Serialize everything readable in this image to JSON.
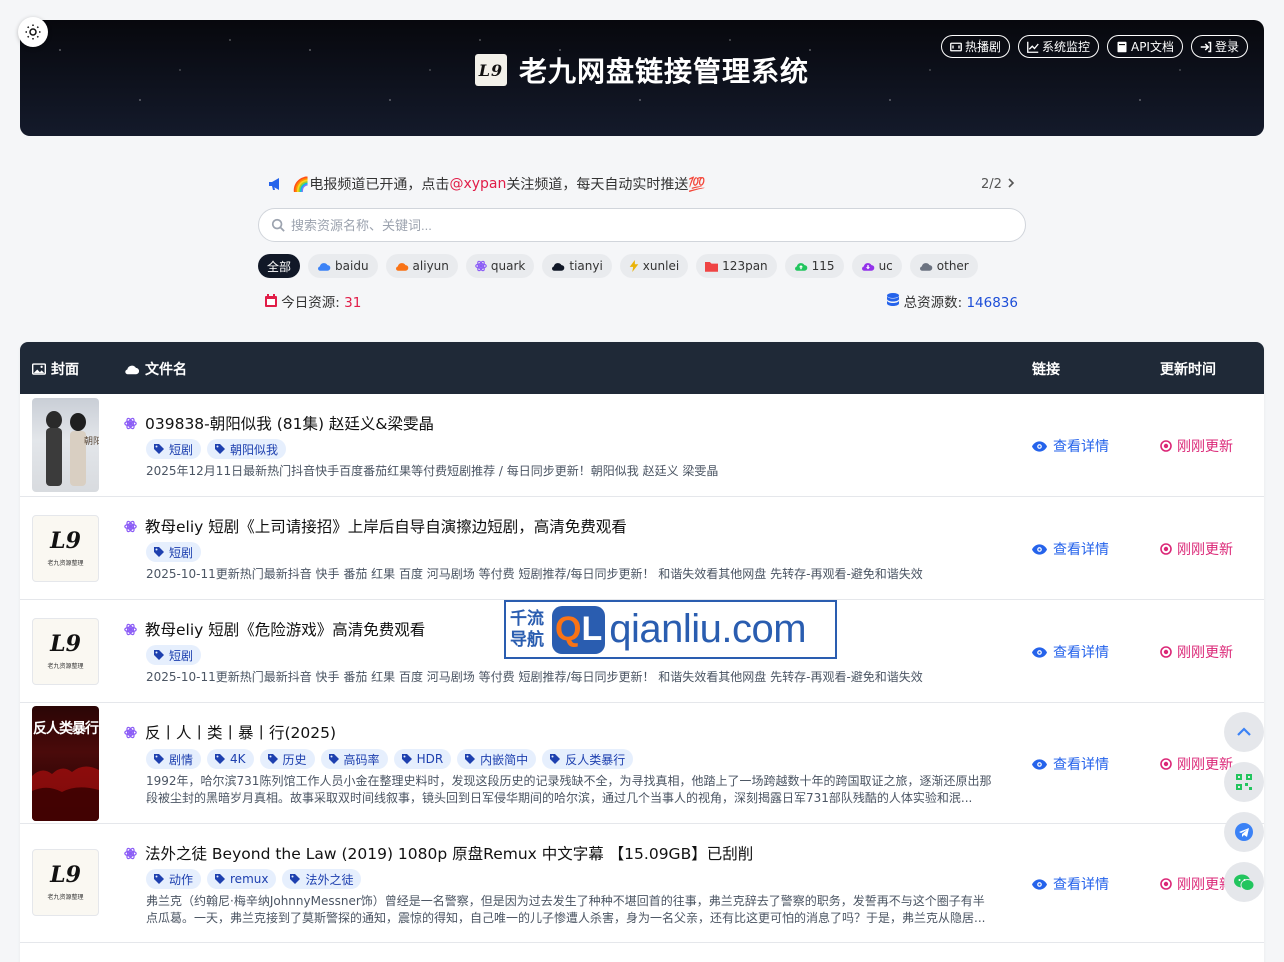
{
  "header": {
    "title": "老九网盘链接管理系统",
    "logo_text": "L9",
    "nav": [
      {
        "label": "热播剧",
        "icon": "tv-icon"
      },
      {
        "label": "系统监控",
        "icon": "chart-line-icon"
      },
      {
        "label": "API文档",
        "icon": "book-icon"
      },
      {
        "label": "登录",
        "icon": "sign-in-icon"
      }
    ]
  },
  "notice": {
    "prefix": "🌈电报频道已开通，点击 ",
    "handle": "@xypan",
    "suffix": " 关注频道，每天自动实时推送💯",
    "pager": "2/2"
  },
  "search": {
    "placeholder": "搜索资源名称、关键词..."
  },
  "filters": [
    {
      "label": "全部",
      "active": true,
      "icon": "",
      "color": ""
    },
    {
      "label": "baidu",
      "icon": "cloud-icon",
      "color": "#3b82f6"
    },
    {
      "label": "aliyun",
      "icon": "cloud-icon",
      "color": "#f97316"
    },
    {
      "label": "quark",
      "icon": "atom-icon",
      "color": "#8b5cf6"
    },
    {
      "label": "tianyi",
      "icon": "cloud-icon",
      "color": "#111827"
    },
    {
      "label": "xunlei",
      "icon": "bolt-icon",
      "color": "#eab308"
    },
    {
      "label": "123pan",
      "icon": "folder-icon",
      "color": "#ef4444"
    },
    {
      "label": "115",
      "icon": "cloud-upload-icon",
      "color": "#22c55e"
    },
    {
      "label": "uc",
      "icon": "cloud-download-icon",
      "color": "#9333ea"
    },
    {
      "label": "other",
      "icon": "cloud-icon",
      "color": "#6b7280"
    }
  ],
  "stats": {
    "today_label": "今日资源: ",
    "today_value": "31",
    "total_label": "总资源数: ",
    "total_value": "146836"
  },
  "table": {
    "headers": {
      "cover": "封面",
      "filename": "文件名",
      "link": "链接",
      "updated": "更新时间"
    },
    "rows": [
      {
        "title": "039838-朝阳似我 (81集) 赵廷义&梁雯晶",
        "tags": [
          "短剧",
          "朝阳似我"
        ],
        "desc": "2025年12月11日最新热门抖音快手百度番茄红果等付费短剧推荐 / 每日同步更新！朝阳似我 赵廷义 梁雯晶",
        "cover": "photo",
        "link_label": "查看详情",
        "updated": "刚刚更新"
      },
      {
        "title": "教母eliy 短剧《上司请接招》上岸后自导自演擦边短剧，高清免费观看",
        "tags": [
          "短剧"
        ],
        "desc": "2025-10-11更新热门最新抖音 快手 番茄 红果 百度 河马剧场 等付费 短剧推荐/每日同步更新！  和谐失效看其他网盘 先转存-再观看-避免和谐失效",
        "cover": "logo",
        "link_label": "查看详情",
        "updated": "刚刚更新"
      },
      {
        "title": "教母eliy 短剧《危险游戏》高清免费观看",
        "tags": [
          "短剧"
        ],
        "desc": "2025-10-11更新热门最新抖音 快手 番茄 红果 百度 河马剧场 等付费 短剧推荐/每日同步更新！  和谐失效看其他网盘 先转存-再观看-避免和谐失效",
        "cover": "logo",
        "link_label": "查看详情",
        "updated": "刚刚更新"
      },
      {
        "title": "反丨人丨类丨暴丨行(2025)",
        "tags": [
          "剧情",
          "4K",
          "历史",
          "高码率",
          "HDR",
          "内嵌简中",
          "反人类暴行"
        ],
        "desc": "1992年，哈尔滨731陈列馆工作人员小金在整理史料时，发现这段历史的记录残缺不全，为寻找真相，他踏上了一场跨越数十年的跨国取证之旅，逐渐还原出那段被尘封的黑暗岁月真相。故事采取双时间线叙事，镜头回到日军侵华期间的哈尔滨，通过几个当事人的视角，深刻揭露日军731部队残酷的人体实验和泯...",
        "cover": "poster",
        "poster_text": "反人类暴行",
        "link_label": "查看详情",
        "updated": "刚刚更新"
      },
      {
        "title": "法外之徒 Beyond the Law (2019) 1080p 原盘Remux 中文字幕 【15.09GB】已刮削",
        "tags": [
          "动作",
          "remux",
          "法外之徒"
        ],
        "desc": "弗兰克（约翰尼·梅辛纳JohnnyMessner饰）曾经是一名警察，但是因为过去发生了种种不堪回首的往事，弗兰克辞去了警察的职务，发誓再不与这个圈子有半点瓜葛。一天，弗兰克接到了莫斯警探的通知，震惊的得知，自己唯一的儿子惨遭人杀害，身为一名父亲，还有比这更可怕的消息了吗？于是，弗兰克从隐居...",
        "cover": "logo",
        "link_label": "查看详情",
        "updated": "刚刚更新"
      }
    ]
  },
  "watermark": {
    "cn_line1": "千流",
    "cn_line2": "导航",
    "badge_q": "Q",
    "badge_l": "L",
    "domain": "qianliu.com"
  },
  "colors": {
    "accent": "#2563eb",
    "danger": "#e11d48",
    "header_bg": "#1f2937",
    "updated": "#db2777"
  }
}
